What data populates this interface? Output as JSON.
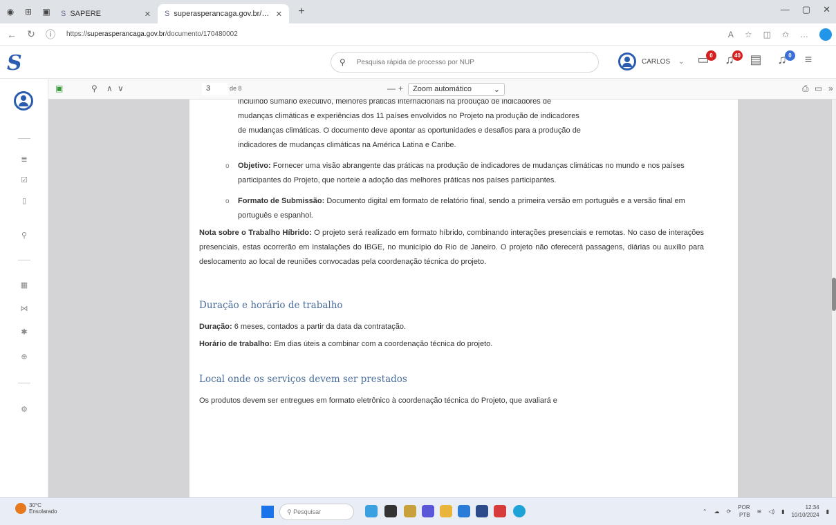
{
  "browser": {
    "tabs": [
      {
        "title": "SAPERE",
        "active": false
      },
      {
        "title": "superasperancaga.gov.br/documen",
        "active": false
      }
    ],
    "url_prefix": "https://",
    "url_host": "superasperancaga.gov.br",
    "url_path": "/documento/170480002"
  },
  "header": {
    "search_placeholder": "Pesquisa rápida de processo por NUP",
    "user_name": "CARLOS",
    "badges": [
      "0",
      "40",
      "0"
    ]
  },
  "pdf_toolbar": {
    "page_value": "3",
    "page_of": "de 8",
    "zoom_out": "—",
    "zoom_in": "+",
    "zoom_label": "Zoom automático"
  },
  "document": {
    "intro_lines": [
      "incluindo sumário executivo, melhores práticas internacionais na produção de indicadores de",
      "mudanças climáticas e experiências dos 11 países envolvidos no Projeto na produção de indicadores",
      "de mudanças climáticas. O documento deve apontar as oportunidades e desafios para a produção de",
      "indicadores de mudanças climáticas na América Latina e Caribe."
    ],
    "bullet_char": "o",
    "objective_label": "Objetivo:",
    "objective_text": "Fornecer uma visão abrangente das práticas na produção de indicadores de mudanças climáticas no mundo e nos países participantes do Projeto, que norteie a adoção das melhores práticas nos países participantes.",
    "format_label": "Formato de Submissão:",
    "format_text": "Documento digital em formato de relatório final, sendo a primeira versão em português e a versão final em português e espanhol.",
    "note_label": "Nota sobre o Trabalho Híbrido:",
    "note_text": "O projeto será realizado em formato híbrido, combinando interações presenciais e remotas. No caso de interações presenciais, estas ocorrerão em instalações do IBGE, no município do Rio de Janeiro. O projeto não oferecerá passagens, diárias ou auxílio para deslocamento ao local de reuniões convocadas pela coordenação técnica do projeto.",
    "section1_title": "Duração e horário de trabalho",
    "duration_label": "Duração:",
    "duration_text": "6 meses, contados a partir da data da contratação.",
    "hours_label": "Horário de trabalho:",
    "hours_text": "Em dias úteis a combinar com a coordenação técnica do projeto.",
    "section2_title": "Local onde os serviços devem ser prestados",
    "last_para": "Os produtos devem ser entregues em formato eletrônico à coordenação técnica do Projeto, que avaliará e"
  },
  "taskbar": {
    "weather_temp": "30°C",
    "weather_desc": "Ensolarado",
    "search_label": "Pesquisar",
    "lang": "POR",
    "lang_sub": "PTB",
    "time": "12:34",
    "date": "10/10/2024"
  },
  "colors": {
    "accent": "#2a5db0",
    "badge": "#d52020",
    "heading": "#4a6e9a"
  }
}
